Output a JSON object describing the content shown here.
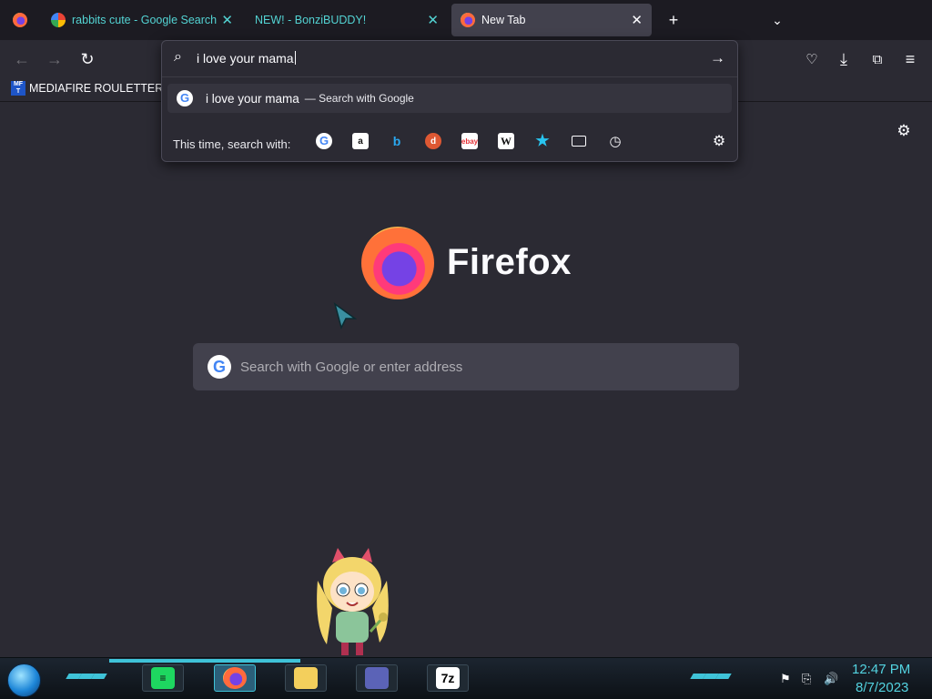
{
  "tabs": [
    {
      "label": "rabbits cute - Google Search",
      "active": false
    },
    {
      "label": "NEW! - BonziBUDDY!",
      "active": false
    },
    {
      "label": "New Tab",
      "active": true
    }
  ],
  "bookmarks": {
    "item_label": "MEDIAFIRE ROULETTER",
    "icon_text": "MF T"
  },
  "urlbar": {
    "value": "i love your mama",
    "suggestion_text": "i love your mama",
    "suggestion_sub": "— Search with Google",
    "search_with_label": "This time, search with:"
  },
  "engines": [
    "google-icon",
    "amazon-icon",
    "bing-icon",
    "duckduckgo-icon",
    "ebay-icon",
    "wikipedia-icon",
    "bookmarks-icon",
    "tabs-icon",
    "history-icon"
  ],
  "newtab": {
    "brand": "Firefox",
    "search_placeholder": "Search with Google or enter address"
  },
  "clock": {
    "time": "12:47 PM",
    "date": "8/7/2023"
  },
  "colors": {
    "accent_cyan": "#53d3d3",
    "bg": "#2b2a33",
    "tabbar": "#1c1b22"
  }
}
